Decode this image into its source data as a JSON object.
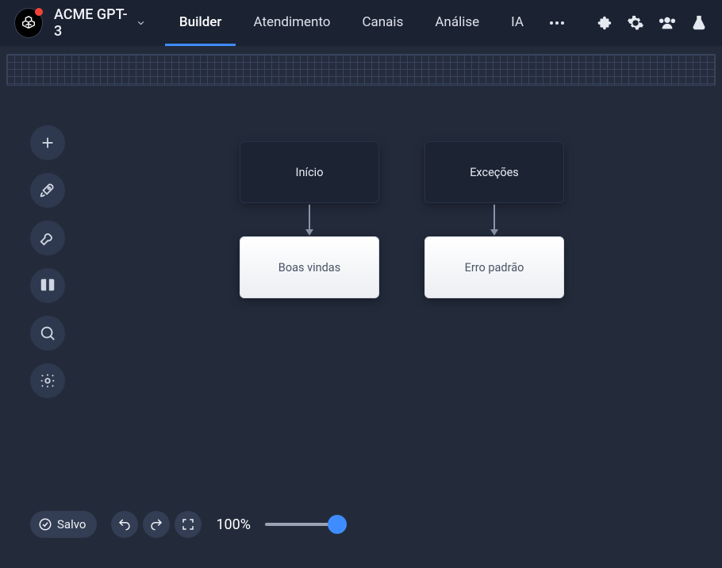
{
  "header": {
    "app_title": "ACME GPT-3",
    "tabs": [
      {
        "label": "Builder",
        "active": true
      },
      {
        "label": "Atendimento"
      },
      {
        "label": "Canais"
      },
      {
        "label": "Análise"
      },
      {
        "label": "IA"
      }
    ]
  },
  "side_tools": [
    {
      "name": "add"
    },
    {
      "name": "rocket"
    },
    {
      "name": "wrench"
    },
    {
      "name": "book"
    },
    {
      "name": "search"
    },
    {
      "name": "variables"
    }
  ],
  "flow": {
    "nodes": {
      "start": {
        "label": "Início"
      },
      "exceptions": {
        "label": "Exceções"
      },
      "welcome": {
        "label": "Boas vindas"
      },
      "default_error": {
        "label": "Erro padrão"
      }
    }
  },
  "bottom": {
    "status_label": "Salvo",
    "zoom_label": "100%"
  }
}
